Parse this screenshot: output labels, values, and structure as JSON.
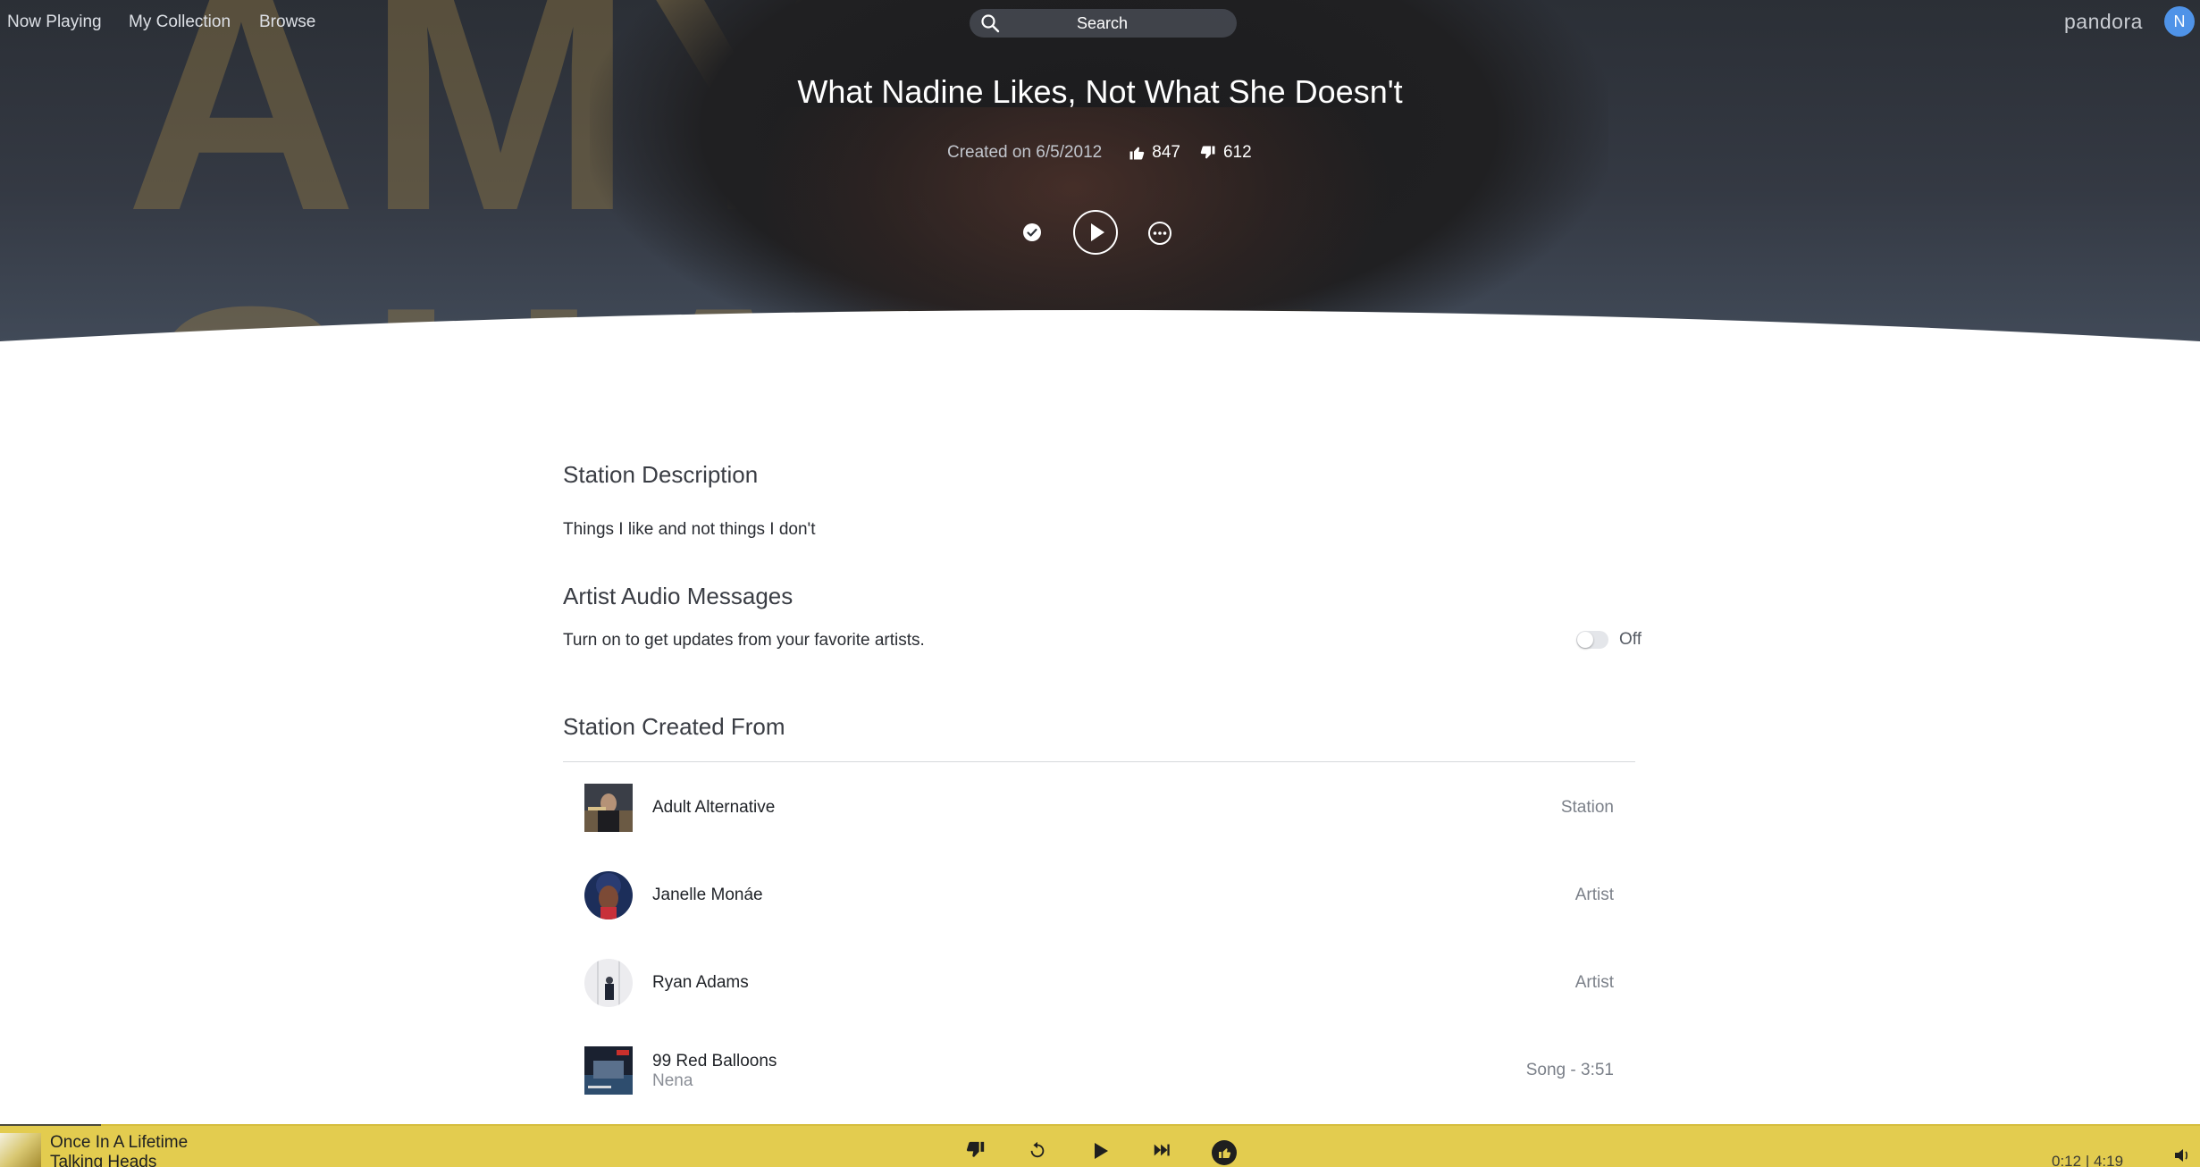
{
  "nav": {
    "now_playing": "Now Playing",
    "my_collection": "My Collection",
    "browse": "Browse",
    "search_placeholder": "Search",
    "brand": "pandora",
    "avatar_initial": "N"
  },
  "hero": {
    "background_text_1": "AMY",
    "background_text_2": "SHARK",
    "station_title": "What Nadine Likes, Not What She Doesn't",
    "created": "Created on 6/5/2012",
    "thumbs_up_count": "847",
    "thumbs_down_count": "612"
  },
  "description": {
    "heading": "Station Description",
    "text": "Things I like and not things I don't"
  },
  "artist_audio_messages": {
    "heading": "Artist Audio Messages",
    "text": "Turn on to get updates from your favorite artists.",
    "toggle_state": "Off"
  },
  "station_created_from": {
    "heading": "Station Created From",
    "items": [
      {
        "name": "Adult Alternative",
        "subtitle": "",
        "type": "Station"
      },
      {
        "name": "Janelle Monáe",
        "subtitle": "",
        "type": "Artist"
      },
      {
        "name": "Ryan Adams",
        "subtitle": "",
        "type": "Artist"
      },
      {
        "name": "99 Red Balloons",
        "subtitle": "Nena",
        "type": "Song - 3:51"
      }
    ]
  },
  "player": {
    "track_title": "Once In A Lifetime",
    "track_artist": "Talking Heads",
    "elapsed": "0:12",
    "duration": "4:19",
    "progress_fraction": 0.046,
    "bar_color": "#e3cc4f"
  },
  "icons": {
    "search": "search-icon",
    "thumbs_up": "thumbs-up-icon",
    "thumbs_down": "thumbs-down-icon",
    "check": "check-icon",
    "play": "play-icon",
    "more": "more-icon",
    "replay": "replay-icon",
    "skip": "skip-icon",
    "volume": "volume-icon"
  }
}
